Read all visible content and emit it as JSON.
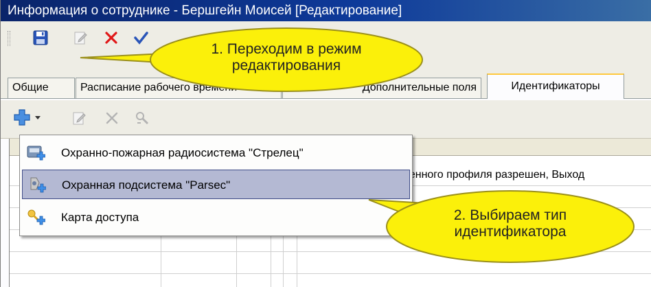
{
  "window": {
    "title": "Информация о сотруднике - Бершгейн Моисей  [Редактирование]"
  },
  "toolbar": {
    "save_icon": "save-icon",
    "edit_icon": "edit-icon",
    "delete_icon": "delete-icon",
    "apply_icon": "check-icon"
  },
  "tabs": [
    {
      "label": "Общие"
    },
    {
      "label": "Расписание рабочего времени"
    },
    {
      "label": "Дополнительные поля"
    },
    {
      "label": "Идентификаторы",
      "active": true
    }
  ],
  "subtoolbar": {
    "add_icon": "add-icon",
    "dropdown_icon": "chevron-down-icon",
    "edit_icon": "edit-icon",
    "delete_icon": "delete-icon",
    "properties_icon": "properties-icon"
  },
  "grid": {
    "row_text": "ненного профиля разрешен, Выход"
  },
  "menu": {
    "items": [
      {
        "label": "Охранно-пожарная радиосистема \"Стрелец\""
      },
      {
        "label": "Охранная подсистема \"Parsec\"",
        "selected": true
      },
      {
        "label": "Карта доступа"
      }
    ]
  },
  "callouts": {
    "first": {
      "line1": "1. Переходим в режим",
      "line2": "редактирования"
    },
    "second": {
      "line1": "2. Выбираем тип",
      "line2": "идентификатора"
    }
  },
  "colors": {
    "callout_fill": "#fbf00a",
    "callout_border": "#9a8f1a",
    "selection": "#b4b9d3",
    "titlebar": "#0a246a"
  }
}
